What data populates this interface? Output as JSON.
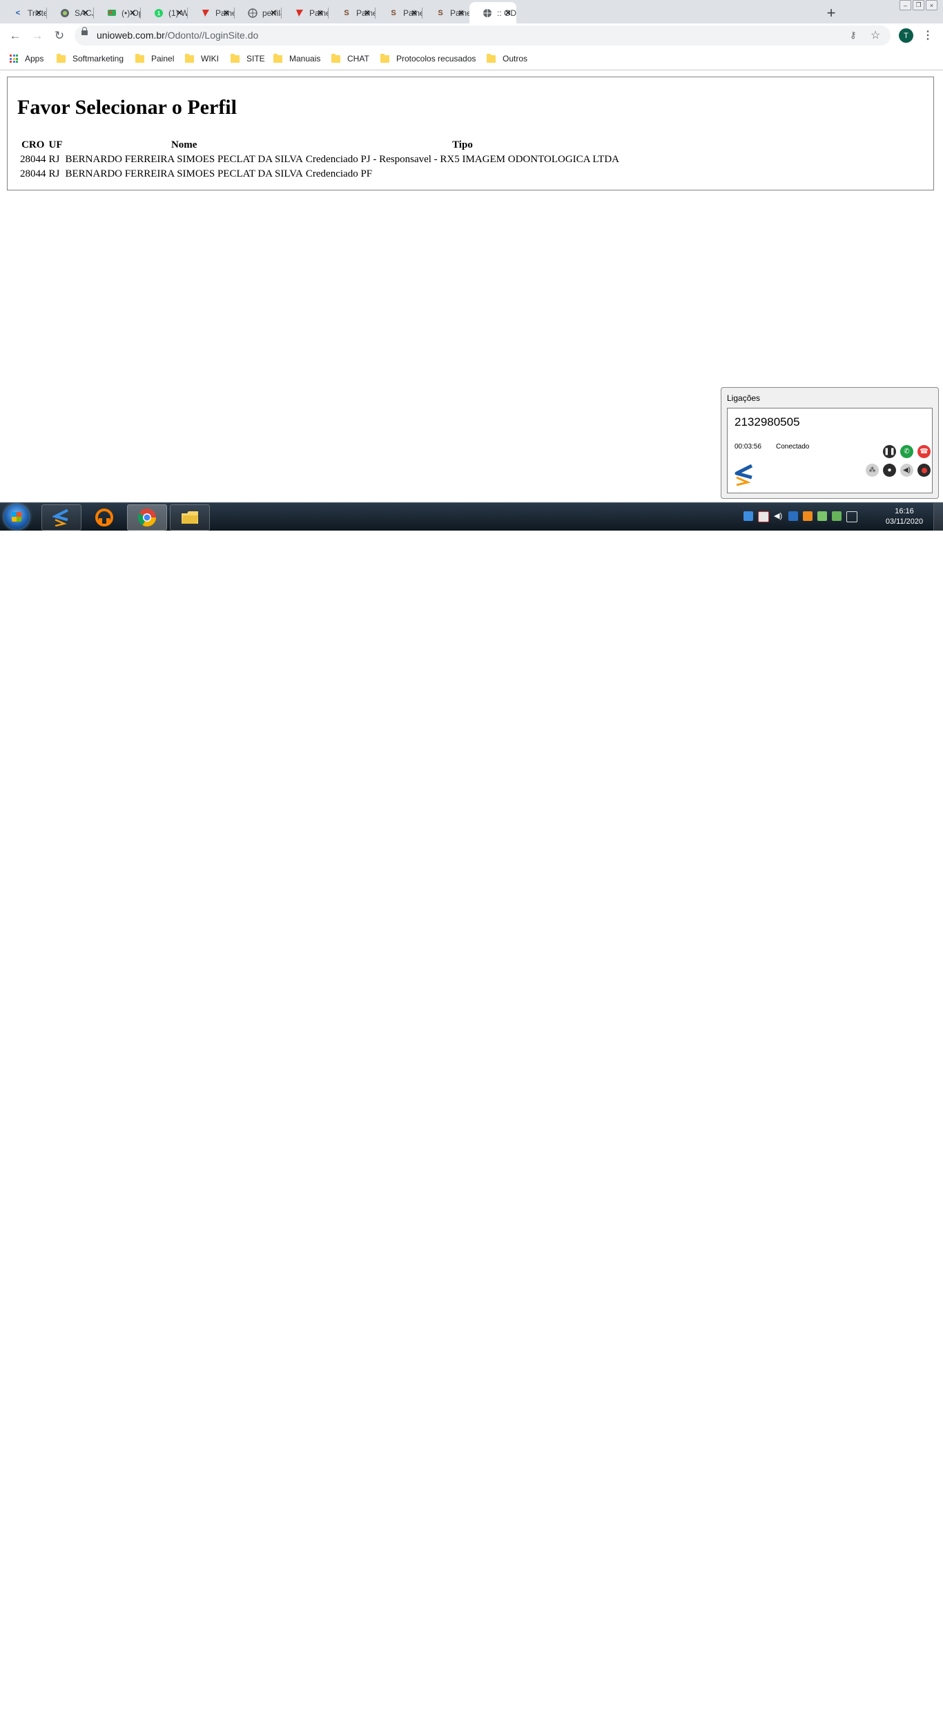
{
  "browser": {
    "tabs": [
      {
        "title": "Tristeria",
        "favicon": "softphone-logo-icon",
        "active": false
      },
      {
        "title": "SACJ - S",
        "favicon": "globe-icon",
        "active": false
      },
      {
        "title": "(•) Oper",
        "favicon": "chat-icon",
        "active": false
      },
      {
        "title": "(1) Wha",
        "favicon": "whatsapp-icon",
        "active": false
      },
      {
        "title": "Painel -",
        "favicon": "panel-icon",
        "active": false
      },
      {
        "title": "perfilato",
        "favicon": "globe-icon",
        "active": false
      },
      {
        "title": "Painel -",
        "favicon": "panel-icon",
        "active": false
      },
      {
        "title": "Painel -",
        "favicon": "s-panel-icon",
        "active": false
      },
      {
        "title": "Painel -",
        "favicon": "s-panel-icon",
        "active": false
      },
      {
        "title": "Painel -",
        "favicon": "s-panel-icon",
        "active": false
      },
      {
        "title": ":: ODON",
        "favicon": "globe-icon",
        "active": true
      }
    ],
    "url_domain": "unioweb.com.br",
    "url_path": "/Odonto//LoginSite.do",
    "profile_initial": "T",
    "bookmarks": [
      {
        "label": "Apps",
        "icon": "apps-grid-icon"
      },
      {
        "label": "Softmarketing",
        "icon": "folder-icon"
      },
      {
        "label": "Painel",
        "icon": "folder-icon"
      },
      {
        "label": "WIKI",
        "icon": "folder-icon"
      },
      {
        "label": "SITE",
        "icon": "folder-icon"
      },
      {
        "label": "Manuais",
        "icon": "folder-icon"
      },
      {
        "label": "CHAT",
        "icon": "folder-icon"
      },
      {
        "label": "Protocolos recusados",
        "icon": "folder-icon"
      },
      {
        "label": "Outros",
        "icon": "folder-icon"
      }
    ]
  },
  "page": {
    "title": "Favor Selecionar o Perfil",
    "columns": {
      "cro": "CRO",
      "uf": "UF",
      "nome": "Nome",
      "tipo": "Tipo"
    },
    "rows": [
      {
        "cro": "28044",
        "uf": "RJ",
        "nome": "BERNARDO FERREIRA SIMOES PECLAT DA SILVA",
        "tipo": "Credenciado PJ - Responsavel - RX5 IMAGEM ODONTOLOGICA LTDA"
      },
      {
        "cro": "28044",
        "uf": "RJ",
        "nome": "BERNARDO FERREIRA SIMOES PECLAT DA SILVA",
        "tipo": "Credenciado PF"
      }
    ]
  },
  "softphone": {
    "window_title": "Ligações",
    "number": "2132980505",
    "duration": "00:03:56",
    "status": "Conectado"
  },
  "taskbar": {
    "time": "16:16",
    "date": "03/11/2020"
  },
  "colors": {
    "tab_strip": "#dee1e6",
    "answer_green": "#1fa046",
    "hangup_red": "#e53935",
    "taskbar": "#1b2835"
  }
}
